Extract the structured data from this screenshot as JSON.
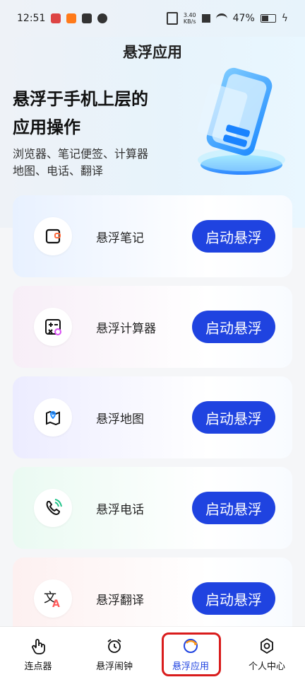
{
  "status_bar": {
    "time": "12:51",
    "speed": "3.40",
    "speed_unit": "KB/s",
    "battery": "47%"
  },
  "page": {
    "title": "悬浮应用",
    "hero_line1": "悬浮于手机上层的",
    "hero_line2": "应用操作",
    "desc_line1": "浏览器、笔记便签、计算器",
    "desc_line2": "地图、电话、翻译"
  },
  "cards": [
    {
      "label": "悬浮笔记",
      "button": "启动悬浮",
      "icon": "note-icon",
      "bg": "#e8f1ff"
    },
    {
      "label": "悬浮计算器",
      "button": "启动悬浮",
      "icon": "calculator-icon",
      "bg": "#f7eef7"
    },
    {
      "label": "悬浮地图",
      "button": "启动悬浮",
      "icon": "map-icon",
      "bg": "#ececff"
    },
    {
      "label": "悬浮电话",
      "button": "启动悬浮",
      "icon": "phone-icon",
      "bg": "#eafaf2"
    },
    {
      "label": "悬浮翻译",
      "button": "启动悬浮",
      "icon": "translate-icon",
      "bg": "#fdf0f0"
    }
  ],
  "nav": [
    {
      "label": "连点器",
      "icon": "tap-hand-icon",
      "active": false
    },
    {
      "label": "悬浮闹钟",
      "icon": "alarm-clock-icon",
      "active": false
    },
    {
      "label": "悬浮应用",
      "icon": "circle-refresh-icon",
      "active": true
    },
    {
      "label": "个人中心",
      "icon": "hexagon-gear-icon",
      "active": false
    }
  ],
  "colors": {
    "accent": "#1f43e0",
    "highlight": "#d91c1c"
  }
}
